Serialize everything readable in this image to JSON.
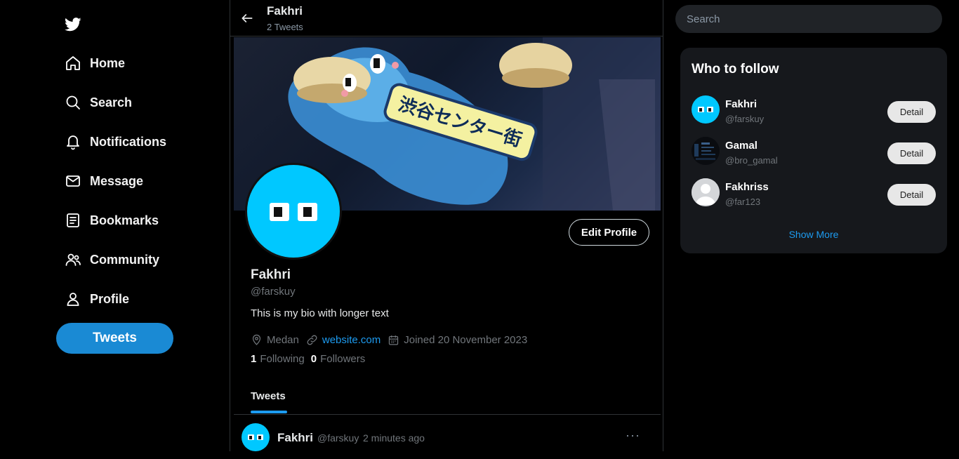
{
  "sidebar": {
    "logo": "twitter-bird-icon",
    "items": [
      {
        "label": "Home",
        "icon": "home-icon"
      },
      {
        "label": "Search",
        "icon": "search-icon"
      },
      {
        "label": "Notifications",
        "icon": "bell-icon"
      },
      {
        "label": "Message",
        "icon": "mail-icon"
      },
      {
        "label": "Bookmarks",
        "icon": "bookmark-icon"
      },
      {
        "label": "Community",
        "icon": "community-icon"
      },
      {
        "label": "Profile",
        "icon": "user-icon"
      }
    ],
    "tweet_button": "Tweets"
  },
  "header": {
    "name": "Fakhri",
    "tweet_count": "2 Tweets"
  },
  "profile": {
    "banner_text": "渋谷センター街",
    "name": "Fakhri",
    "handle": "@farskuy",
    "bio": "This is my bio with longer text",
    "location": "Medan",
    "website": "website.com",
    "joined": "Joined 20 November 2023",
    "following_count": "1",
    "following_label": "Following",
    "followers_count": "0",
    "followers_label": "Followers",
    "edit_label": "Edit Profile"
  },
  "tabs": {
    "active": "Tweets"
  },
  "tweet": {
    "name": "Fakhri",
    "handle": "@farskuy",
    "time": "2 minutes ago",
    "more": "···"
  },
  "right": {
    "search_placeholder": "Search",
    "who_to_follow": {
      "title": "Who to follow",
      "users": [
        {
          "name": "Fakhri",
          "handle": "@farskuy",
          "button": "Detail"
        },
        {
          "name": "Gamal",
          "handle": "@bro_gamal",
          "button": "Detail"
        },
        {
          "name": "Fakhriss",
          "handle": "@far123",
          "button": "Detail"
        }
      ],
      "show_more": "Show More"
    }
  },
  "colors": {
    "accent": "#1d9bf0",
    "tweet_button": "#1a8ad4",
    "avatar": "#00c8ff",
    "panel": "#16181c"
  }
}
